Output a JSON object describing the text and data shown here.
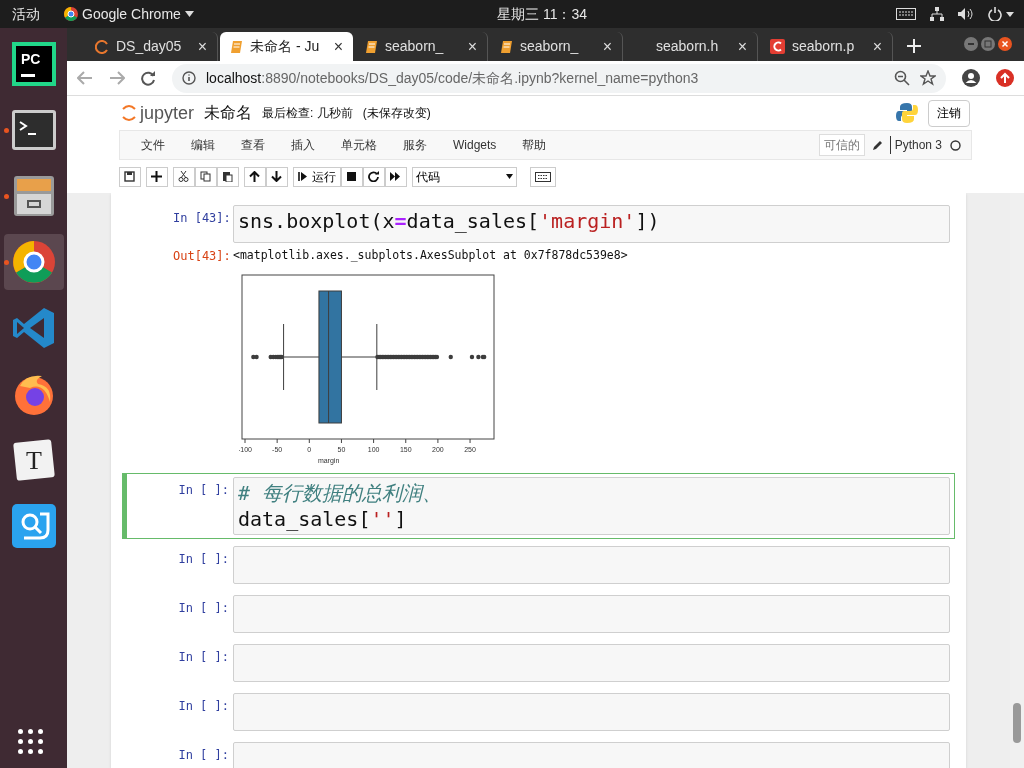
{
  "top_bar": {
    "activities": "活动",
    "app": "Google Chrome",
    "clock": "星期三 11：34"
  },
  "dock": [
    {
      "kind": "pycharm",
      "label": "PC",
      "running": false,
      "selected": false
    },
    {
      "kind": "terminal",
      "running": true,
      "selected": false
    },
    {
      "kind": "files",
      "running": true,
      "selected": false
    },
    {
      "kind": "chrome",
      "running": true,
      "selected": true
    },
    {
      "kind": "vscode",
      "running": false,
      "selected": false
    },
    {
      "kind": "firefox",
      "running": false,
      "selected": false
    },
    {
      "kind": "typora",
      "label": "T",
      "running": false,
      "selected": false
    },
    {
      "kind": "screenshot",
      "running": false,
      "selected": false
    }
  ],
  "tabs": [
    {
      "title": "DS_day05",
      "kind": "spinner",
      "close": "×",
      "selected": false
    },
    {
      "title": "未命名 - Ju",
      "kind": "notebook",
      "close": "×",
      "selected": true
    },
    {
      "title": "seaborn_",
      "kind": "notebook",
      "close": "×",
      "selected": false
    },
    {
      "title": "seaborn_",
      "kind": "notebook",
      "close": "×",
      "selected": false
    },
    {
      "title": "seaborn.h",
      "kind": "blank",
      "close": "×",
      "selected": false
    },
    {
      "title": "seaborn.p",
      "kind": "csdn",
      "close": "×",
      "selected": false
    }
  ],
  "address": {
    "host": "localhost",
    "path": ":8890/notebooks/DS_day05/code/未命名.ipynb?kernel_name=python3"
  },
  "jupyter": {
    "logo": "jupyter",
    "name": "未命名",
    "checkpoint": "最后检查: 几秒前",
    "unsaved": "(未保存改变)",
    "logout": "注销",
    "menu": [
      "文件",
      "编辑",
      "查看",
      "插入",
      "单元格",
      "服务",
      "Widgets",
      "帮助"
    ],
    "trusted": "可信的",
    "kernel": "Python 3",
    "run": "运行",
    "cell_type": "代码"
  },
  "cells": [
    {
      "prompt": "In [43]:",
      "selected": false,
      "lines": [
        [
          {
            "kind": "plain",
            "text": "sns.boxplot(x"
          },
          {
            "kind": "op",
            "text": "="
          },
          {
            "kind": "plain",
            "text": "data_sales["
          },
          {
            "kind": "string",
            "text": "'margin'"
          },
          {
            "kind": "plain",
            "text": "])"
          }
        ]
      ],
      "output": {
        "prompt": "Out[43]:",
        "text": "<matplotlib.axes._subplots.AxesSubplot at 0x7f878dc539e8>",
        "plot": {
          "xticks": [
            "-100",
            "-50",
            "0",
            "50",
            "100",
            "150",
            "200",
            "250"
          ],
          "xlabel": "margin"
        }
      }
    },
    {
      "prompt": "In [ ]:",
      "selected": true,
      "lines": [
        [
          {
            "kind": "comment",
            "text": "# 每行数据的总利润、"
          }
        ],
        [
          {
            "kind": "plain",
            "text": "data_sales["
          },
          {
            "kind": "string",
            "text": "''"
          },
          {
            "kind": "plain",
            "text": "]"
          }
        ]
      ]
    },
    {
      "prompt": "In [ ]:",
      "selected": false
    },
    {
      "prompt": "In [ ]:",
      "selected": false
    },
    {
      "prompt": "In [ ]:",
      "selected": false
    },
    {
      "prompt": "In [ ]:",
      "selected": false
    },
    {
      "prompt": "In [ ]:",
      "selected": false
    }
  ]
}
